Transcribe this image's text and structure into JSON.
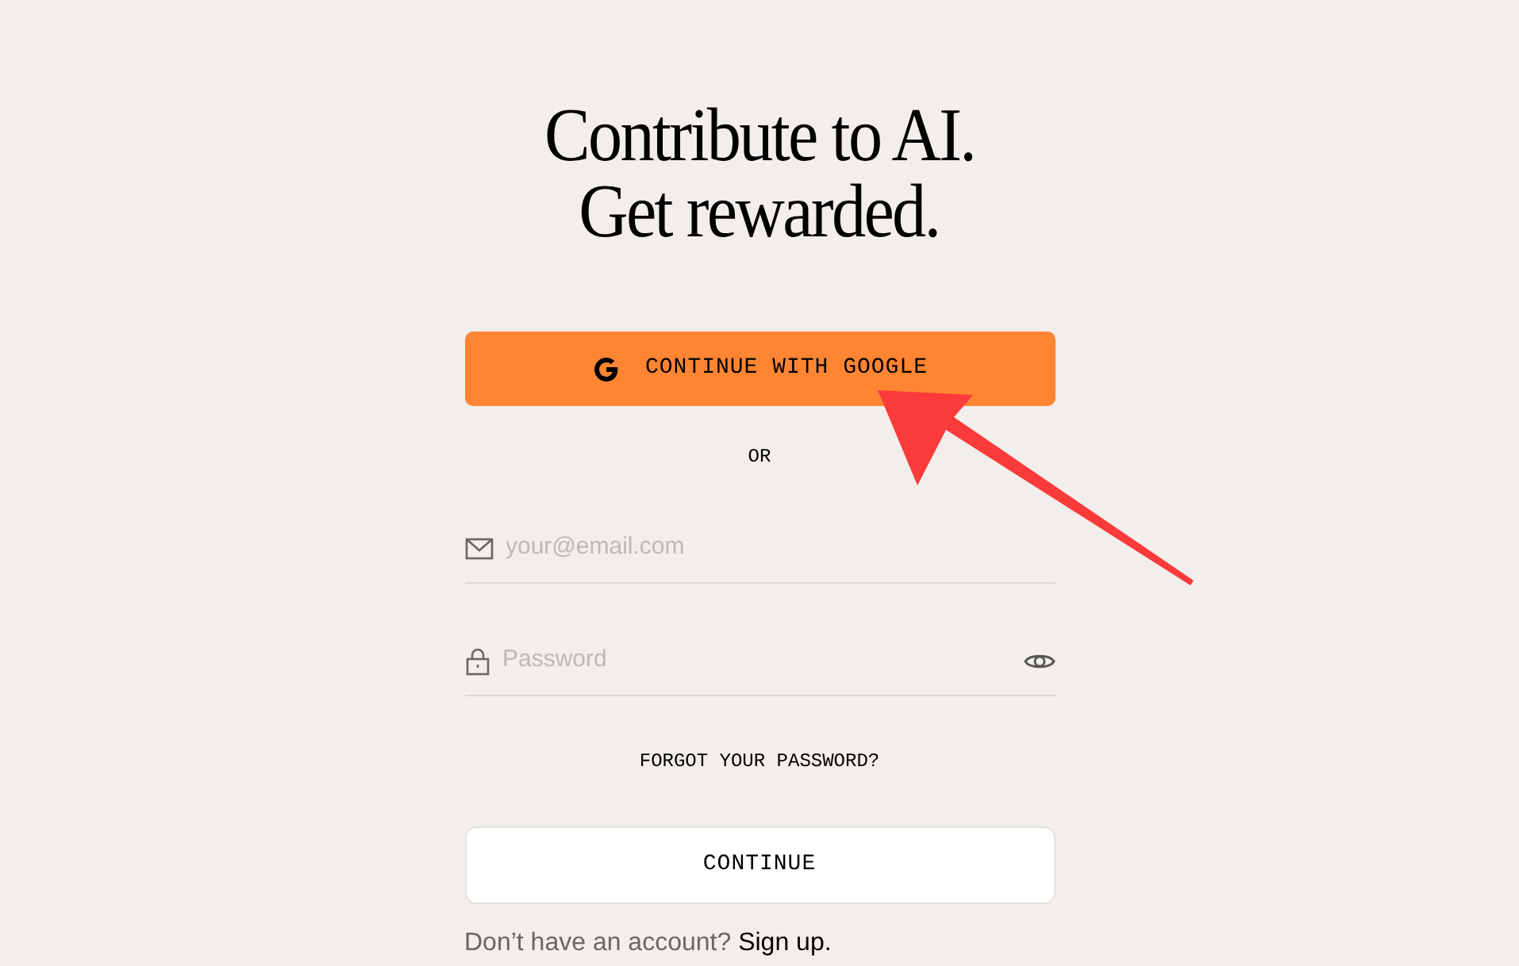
{
  "heading": [
    "Contribute to AI.",
    "Get rewarded."
  ],
  "google_button": {
    "label": "CONTINUE WITH GOOGLE"
  },
  "separator": "OR",
  "email_field": {
    "placeholder": "your@email.com"
  },
  "password_field": {
    "placeholder": "Password"
  },
  "forgot_link": "FORGOT YOUR PASSWORD?",
  "continue_button": "CONTINUE",
  "signup": {
    "text": "Don’t have an account?",
    "link": "Sign up."
  }
}
